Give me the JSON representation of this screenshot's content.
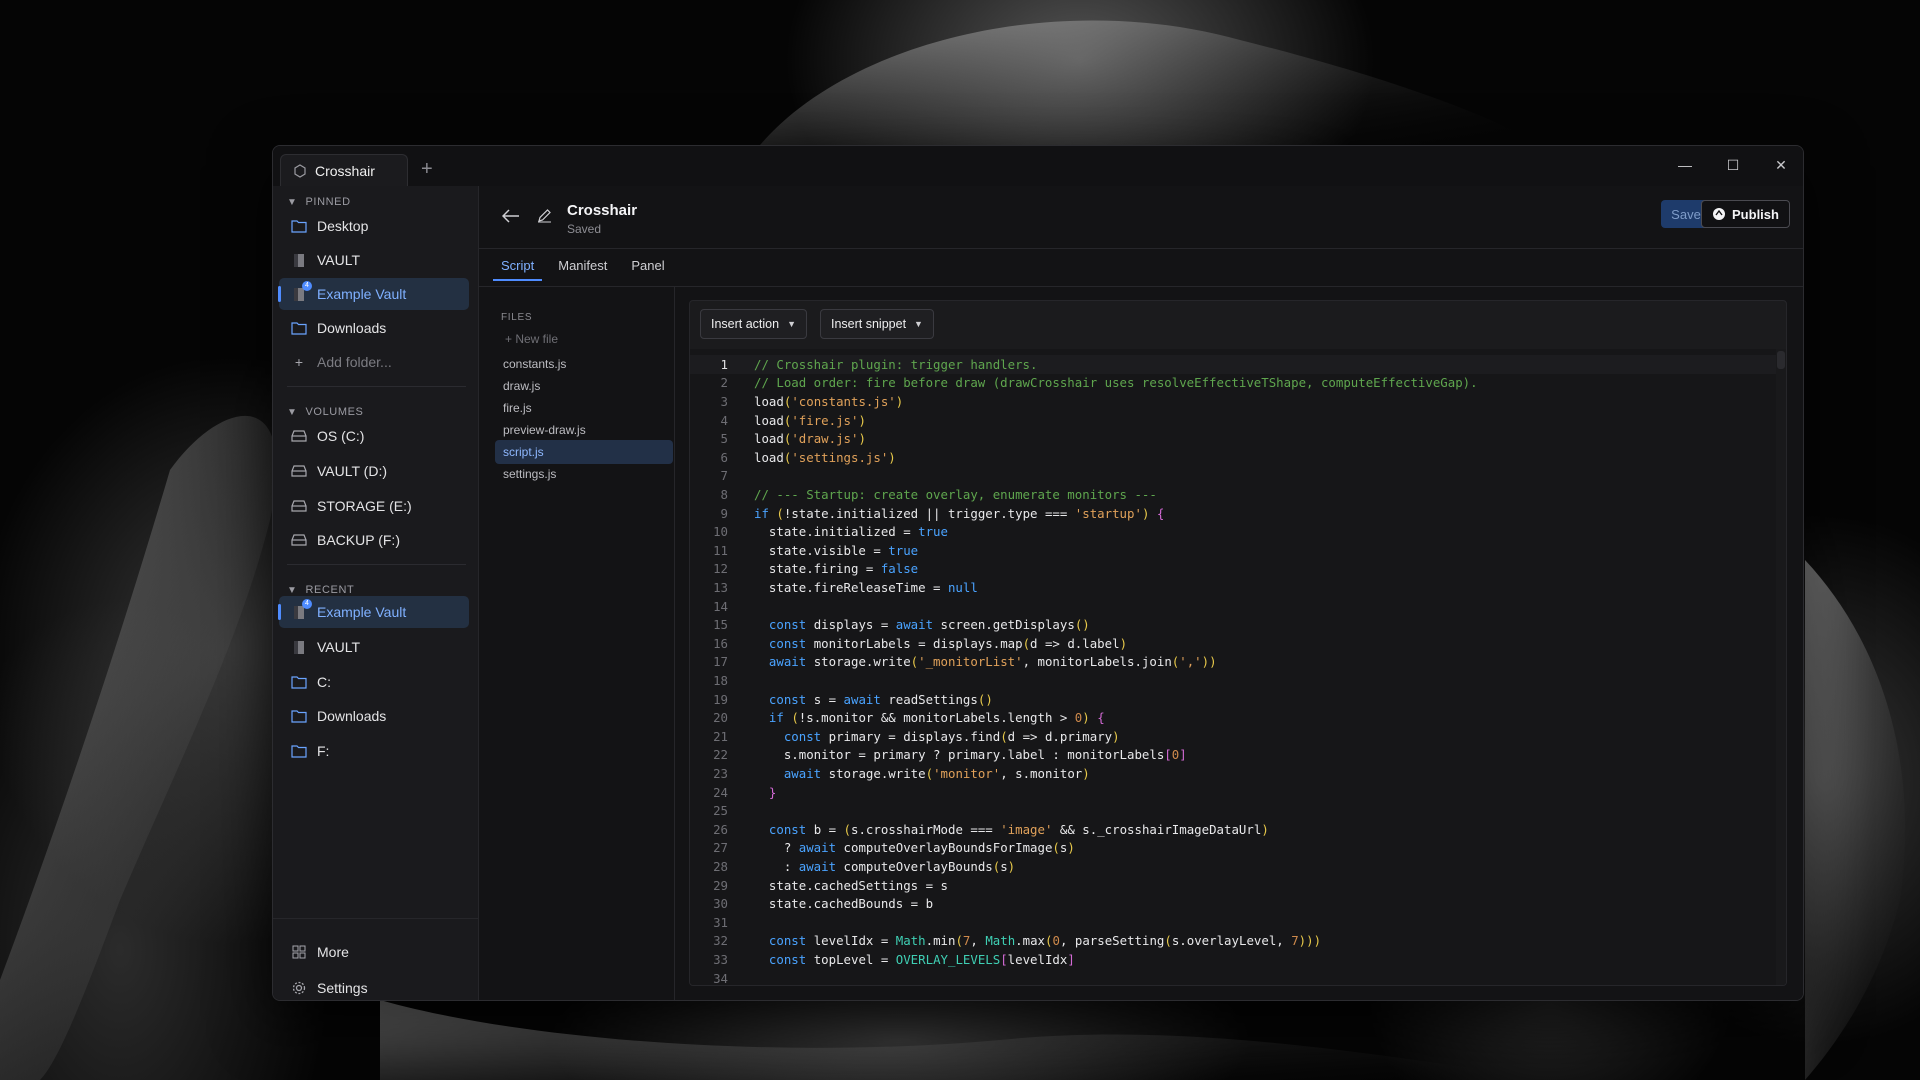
{
  "window": {
    "tab_title": "Crosshair",
    "controls": {
      "minimize": "—",
      "maximize": "☐",
      "close": "✕"
    }
  },
  "sidebar": {
    "pinned_title": "PINNED",
    "pinned": [
      {
        "label": "Desktop",
        "icon": "folder-icon"
      },
      {
        "label": "VAULT",
        "icon": "drive-icon"
      },
      {
        "label": "Example Vault",
        "icon": "vault-icon",
        "active": true,
        "badge": "4"
      },
      {
        "label": "Downloads",
        "icon": "folder-icon"
      }
    ],
    "add_folder": "Add folder...",
    "volumes_title": "VOLUMES",
    "volumes": [
      {
        "label": "OS (C:)"
      },
      {
        "label": "VAULT (D:)"
      },
      {
        "label": "STORAGE (E:)"
      },
      {
        "label": "BACKUP (F:)"
      }
    ],
    "recent_title": "RECENT",
    "recent": [
      {
        "label": "Example Vault",
        "active": true,
        "badge": "4"
      },
      {
        "label": "VAULT"
      },
      {
        "label": "C:"
      },
      {
        "label": "Downloads"
      },
      {
        "label": "F:"
      }
    ],
    "more": "More",
    "settings": "Settings"
  },
  "header": {
    "title": "Crosshair",
    "status": "Saved",
    "save_label": "Save",
    "publish_label": "Publish"
  },
  "tabs": [
    "Script",
    "Manifest",
    "Panel"
  ],
  "files": {
    "heading": "FILES",
    "new_file": "New file",
    "items": [
      "constants.js",
      "draw.js",
      "fire.js",
      "preview-draw.js",
      "script.js",
      "settings.js"
    ],
    "selected": "script.js"
  },
  "editor": {
    "insert_action": "Insert action",
    "insert_snippet": "Insert snippet",
    "lines": [
      "// Crosshair plugin: trigger handlers.",
      "// Load order: fire before draw (drawCrosshair uses resolveEffectiveTShape, computeEffectiveGap).",
      "load('constants.js')",
      "load('fire.js')",
      "load('draw.js')",
      "load('settings.js')",
      "",
      "// --- Startup: create overlay, enumerate monitors ---",
      "if (!state.initialized || trigger.type === 'startup') {",
      "  state.initialized = true",
      "  state.visible = true",
      "  state.firing = false",
      "  state.fireReleaseTime = null",
      "",
      "  const displays = await screen.getDisplays()",
      "  const monitorLabels = displays.map(d => d.label)",
      "  await storage.write('_monitorList', monitorLabels.join(','))",
      "",
      "  const s = await readSettings()",
      "  if (!s.monitor && monitorLabels.length > 0) {",
      "    const primary = displays.find(d => d.primary)",
      "    s.monitor = primary ? primary.label : monitorLabels[0]",
      "    await storage.write('monitor', s.monitor)",
      "  }",
      "",
      "  const b = (s.crosshairMode === 'image' && s._crosshairImageDataUrl)",
      "    ? await computeOverlayBoundsForImage(s)",
      "    : await computeOverlayBounds(s)",
      "  state.cachedSettings = s",
      "  state.cachedBounds = b",
      "",
      "  const levelIdx = Math.min(7, Math.max(0, parseSetting(s.overlayLevel, 7)))",
      "  const topLevel = OVERLAY_LEVELS[levelIdx]",
      ""
    ]
  },
  "colors": {
    "accent": "#4f8cff",
    "active_bg": "#233042",
    "comment": "#5fa64e",
    "string": "#e0a15a",
    "keyword": "#4aa3ff"
  }
}
